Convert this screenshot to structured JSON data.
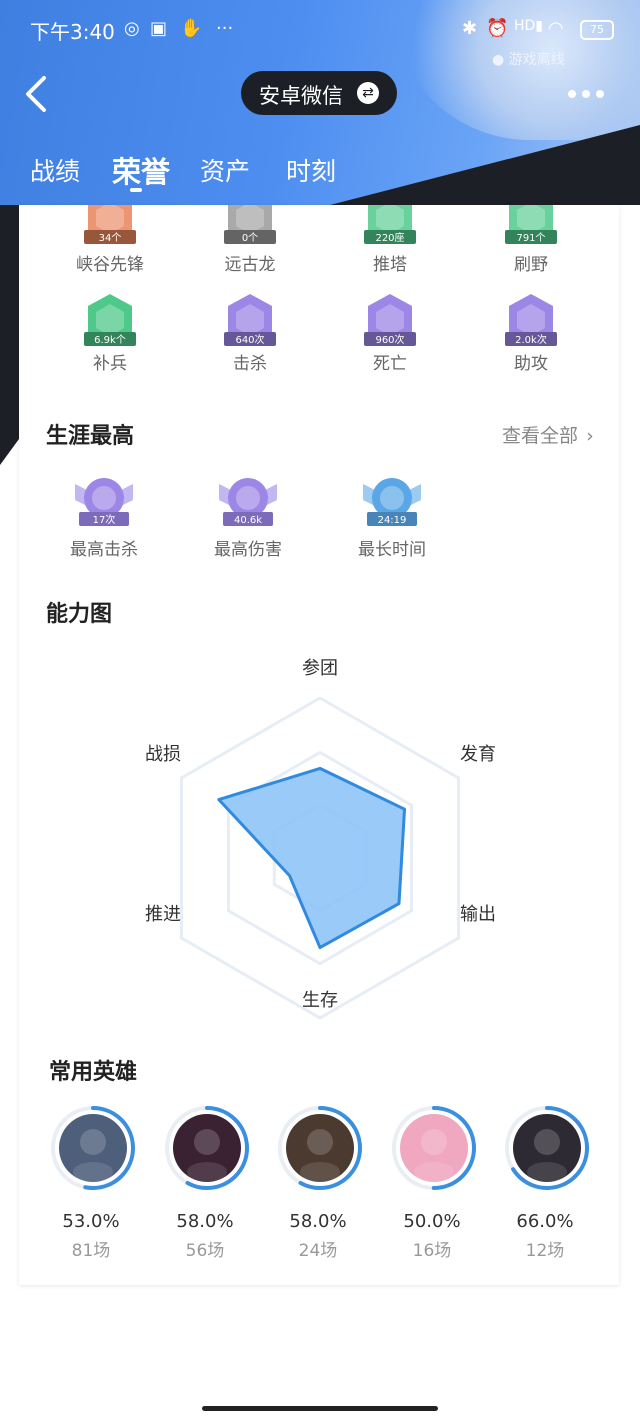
{
  "status_bar": {
    "time": "下午3:40",
    "battery": "75",
    "game_status": "● 游戏离线"
  },
  "header": {
    "account": "安卓微信",
    "switch_glyph": "⇄"
  },
  "tabs": [
    {
      "label": "战绩",
      "active": false
    },
    {
      "label": "荣誉",
      "active": true
    },
    {
      "label": "资产",
      "active": false
    },
    {
      "label": "时刻",
      "active": false
    }
  ],
  "honor_badges": [
    {
      "label": "峡谷先锋",
      "value": "34个",
      "color": "#e8835a"
    },
    {
      "label": "远古龙",
      "value": "0个",
      "color": "#9a9a9a"
    },
    {
      "label": "推塔",
      "value": "220座",
      "color": "#4fc98a"
    },
    {
      "label": "刷野",
      "value": "791个",
      "color": "#4fc98a"
    },
    {
      "label": "补兵",
      "value": "6.9k个",
      "color": "#4fc98a"
    },
    {
      "label": "击杀",
      "value": "640次",
      "color": "#9c86e6"
    },
    {
      "label": "死亡",
      "value": "960次",
      "color": "#9c86e6"
    },
    {
      "label": "助攻",
      "value": "2.0k次",
      "color": "#9c86e6"
    }
  ],
  "career_best": {
    "title": "生涯最高",
    "see_all": "查看全部",
    "items": [
      {
        "label": "最高击杀",
        "value": "17次",
        "color": "#9c86e6"
      },
      {
        "label": "最高伤害",
        "value": "40.6k",
        "color": "#9c86e6"
      },
      {
        "label": "最长时间",
        "value": "24:19",
        "color": "#5aa6e6"
      }
    ]
  },
  "ability_chart": {
    "title": "能力图"
  },
  "chart_data": {
    "type": "radar",
    "axes": [
      "参团",
      "发育",
      "输出",
      "生存",
      "推进",
      "战损"
    ],
    "values": [
      0.56,
      0.61,
      0.57,
      0.56,
      0.22,
      0.73
    ],
    "max": 1,
    "fill_color": "#8ec4f7",
    "line_color": "#2f8ae0"
  },
  "heroes": {
    "title": "常用英雄",
    "list": [
      {
        "win_rate": "53.0%",
        "games": "81场",
        "ring": 0.53,
        "bg": "#4d5f7a"
      },
      {
        "win_rate": "58.0%",
        "games": "56场",
        "ring": 0.58,
        "bg": "#3a2233"
      },
      {
        "win_rate": "58.0%",
        "games": "24场",
        "ring": 0.58,
        "bg": "#4a3a30"
      },
      {
        "win_rate": "50.0%",
        "games": "16场",
        "ring": 0.5,
        "bg": "#f0a8c0"
      },
      {
        "win_rate": "66.0%",
        "games": "12场",
        "ring": 0.66,
        "bg": "#2e2a33"
      }
    ]
  }
}
